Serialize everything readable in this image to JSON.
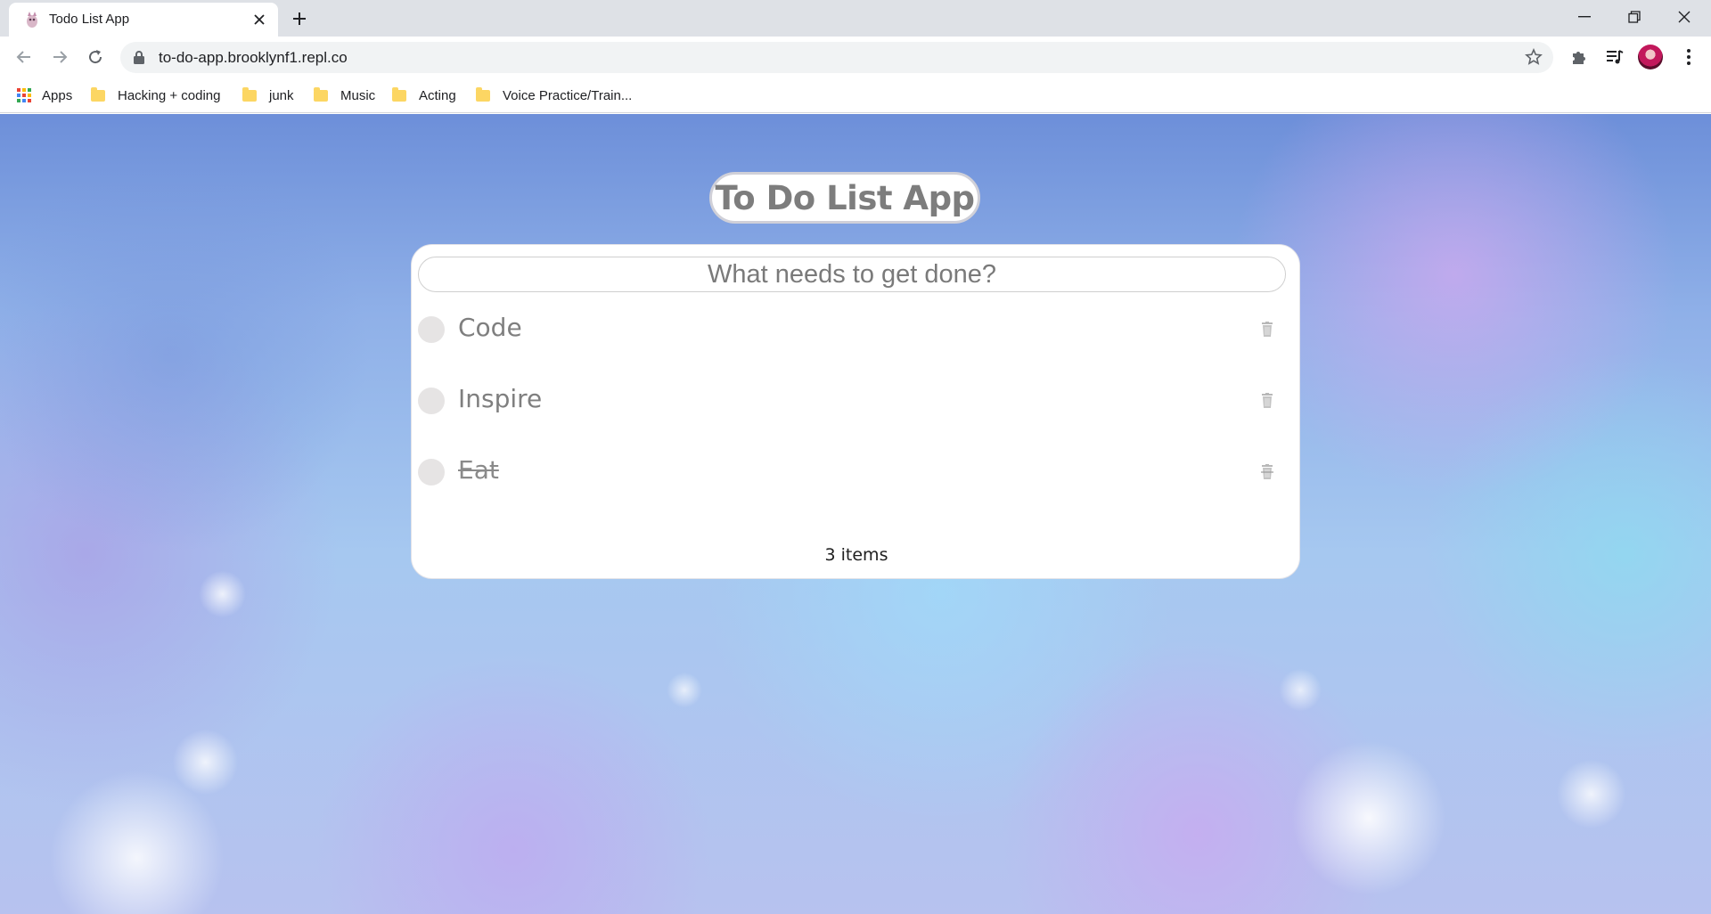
{
  "browser": {
    "tab_title": "Todo List App",
    "url": "to-do-app.brooklynf1.repl.co",
    "bookmarks": [
      {
        "label": "Apps",
        "icon": "apps-grid-icon"
      },
      {
        "label": "Hacking + coding",
        "icon": "folder-icon"
      },
      {
        "label": "junk",
        "icon": "folder-icon"
      },
      {
        "label": "Music",
        "icon": "folder-icon"
      },
      {
        "label": "Acting",
        "icon": "folder-icon"
      },
      {
        "label": "Voice Practice/Train...",
        "icon": "folder-icon"
      }
    ]
  },
  "app": {
    "title": "To Do List App",
    "input_placeholder": "What needs to get done?",
    "todos": [
      {
        "text": "Code",
        "completed": false
      },
      {
        "text": "Inspire",
        "completed": false
      },
      {
        "text": "Eat",
        "completed": true
      }
    ],
    "count_label": "3 items"
  },
  "colors": {
    "title_text": "#7d7d7d",
    "todo_text": "#7f7f7f",
    "checkbox": "#e6e4e4",
    "background_top": "#6d8fd9",
    "background_bottom": "#b7c2ef"
  }
}
